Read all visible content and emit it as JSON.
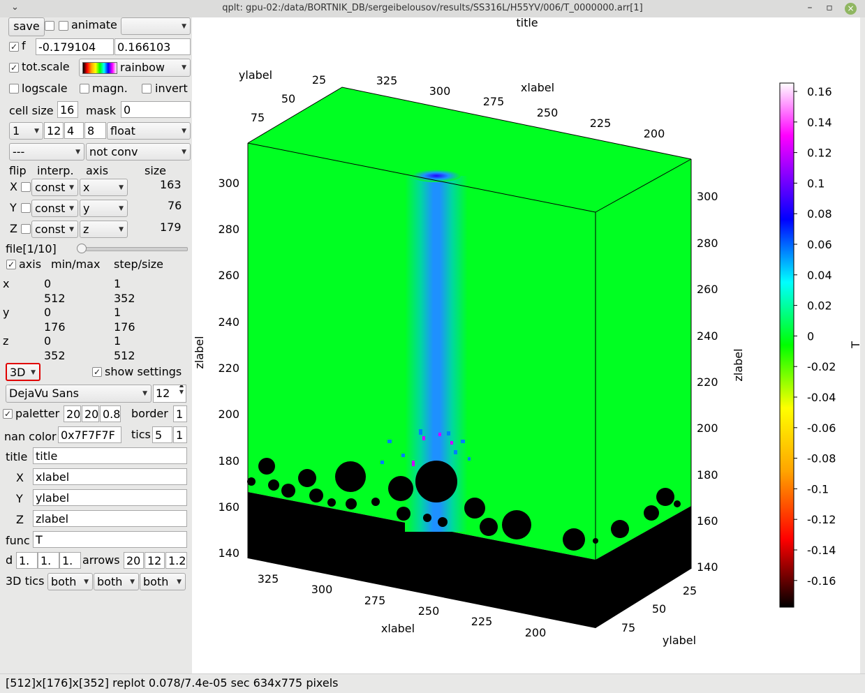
{
  "window": {
    "title": "qplt: gpu-02:/data/BORTNIK_DB/sergeibelousov/results/SS316L/H55YV/006/T_0000000.arr[1]",
    "menu_glyph": "⌄",
    "minimize_glyph": "–",
    "maximize_glyph": "▫",
    "close_glyph": "×"
  },
  "controls": {
    "save_label": "save",
    "animate_label": "animate",
    "animate_select": "",
    "f_label": "f",
    "f_min": "-0.179104",
    "f_max": "0.166103",
    "totscale_label": "tot.scale",
    "palette_select": "rainbow",
    "logscale_label": "logscale",
    "magn_label": "magn.",
    "invert_label": "invert",
    "cellsize_label": "cell size",
    "cellsize_value": "16",
    "mask_label": "mask",
    "mask_value": "0",
    "dim_select": "1",
    "dim_a": "12",
    "dim_b": "4",
    "dim_c": "8",
    "type_select": "float",
    "mode_select": "---",
    "conv_select": "not conv",
    "hdr_flip": "flip",
    "hdr_interp": "interp.",
    "hdr_axis": "axis",
    "hdr_size": "size",
    "rows": [
      {
        "name": "X",
        "interp": "const",
        "axis": "x",
        "size": "163"
      },
      {
        "name": "Y",
        "interp": "const",
        "axis": "y",
        "size": "76"
      },
      {
        "name": "Z",
        "interp": "const",
        "axis": "z",
        "size": "179"
      }
    ],
    "file_label": "file[1/10]",
    "axis_label": "axis",
    "minmax_label": "min/max",
    "stepsize_label": "step/size",
    "ranges": [
      {
        "name": "x",
        "min": "0",
        "max": "512",
        "step": "1",
        "size": "352"
      },
      {
        "name": "y",
        "min": "0",
        "max": "176",
        "step": "1",
        "size": "176"
      },
      {
        "name": "z",
        "min": "0",
        "max": "352",
        "step": "1",
        "size": "512"
      }
    ],
    "view_select": "3D",
    "show_settings_label": "show settings",
    "font_select": "DejaVu Sans",
    "font_size": "12",
    "paletter_label": "paletter",
    "pal_a": "20",
    "pal_b": "20",
    "pal_c": "0.8",
    "border_label": "border",
    "border_value": "1",
    "nancolor_label": "nan color",
    "nancolor_value": "0x7F7F7F",
    "tics_label": "tics",
    "tics_a": "5",
    "tics_b": "1",
    "title_label": "title",
    "title_value": "title",
    "x_label": "X",
    "x_value": "xlabel",
    "y_label": "Y",
    "y_value": "ylabel",
    "z_label": "Z",
    "z_value": "zlabel",
    "func_label": "func",
    "func_value": "T",
    "d_label": "d",
    "d_a": "1.",
    "d_b": "1.",
    "d_c": "1.",
    "arrows_label": "arrows",
    "arr_a": "20",
    "arr_b": "12",
    "arr_c": "1.2",
    "tics3d_label": "3D tics",
    "tics3d_a": "both",
    "tics3d_b": "both",
    "tics3d_c": "both"
  },
  "status": {
    "text": "[512]x[176]x[352] replot 0.078/7.4e-05 sec  634x775 pixels"
  },
  "colors": {
    "field_green": "#00ff22",
    "particle_black": "#000000",
    "highlight_red": "#e00000"
  },
  "chart_data": {
    "type": "heatmap",
    "title": "title",
    "xlabel": "xlabel",
    "ylabel": "ylabel",
    "zlabel": "zlabel",
    "colorbar_label": "T",
    "colormap": "rainbow",
    "color_range": [
      -0.179104,
      0.166103
    ],
    "colorbar_ticks": [
      "0.16",
      "0.14",
      "0.12",
      "0.1",
      "0.08",
      "0.06",
      "0.04",
      "0.02",
      "0",
      "-0.02",
      "-0.04",
      "-0.06",
      "-0.08",
      "-0.1",
      "-0.12",
      "-0.14",
      "-0.16"
    ],
    "z_ticks": [
      "300",
      "280",
      "260",
      "240",
      "220",
      "200",
      "180",
      "160",
      "140"
    ],
    "top_y_ticks": [
      "25",
      "50",
      "75"
    ],
    "top_x_ticks": [
      "325",
      "300",
      "275",
      "250",
      "225",
      "200"
    ],
    "bottom_x_ticks": [
      "325",
      "300",
      "275",
      "250",
      "225",
      "200"
    ],
    "bottom_y_ticks": [
      "25",
      "50",
      "75"
    ],
    "right_z_ticks": [
      "300",
      "280",
      "260",
      "240",
      "220",
      "200",
      "180",
      "160",
      "140"
    ]
  }
}
